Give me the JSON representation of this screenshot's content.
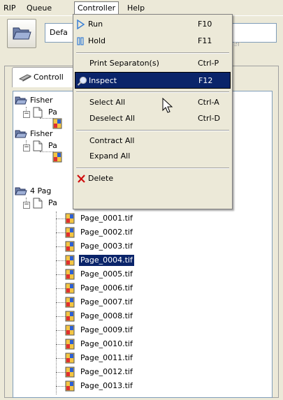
{
  "menubar": {
    "items": [
      {
        "label": "RIP"
      },
      {
        "label": "Queue"
      },
      {
        "label": "Controller"
      },
      {
        "label": "Help"
      }
    ]
  },
  "toolbar": {
    "combo_value": "Defa",
    "combo_ghost_text": "er"
  },
  "tab": {
    "label": "Controll"
  },
  "tree": {
    "groups": [
      {
        "label": "Fisher",
        "child": "Pa"
      },
      {
        "label": "Fisher",
        "child": "Pa"
      },
      {
        "label": "4 Pag",
        "child": "Pa"
      }
    ],
    "pages": [
      "Page_0001.tif",
      "Page_0002.tif",
      "Page_0003.tif",
      "Page_0004.tif",
      "Page_0005.tif",
      "Page_0006.tif",
      "Page_0007.tif",
      "Page_0008.tif",
      "Page_0009.tif",
      "Page_0010.tif",
      "Page_0011.tif",
      "Page_0012.tif",
      "Page_0013.tif"
    ],
    "selected_page": "Page_0004.tif"
  },
  "controller_menu": {
    "run": {
      "label": "Run",
      "shortcut": "F10"
    },
    "hold": {
      "label": "Hold",
      "shortcut": "F11"
    },
    "print_separations": {
      "label": "Print Separaton(s)",
      "shortcut": "Ctrl-P"
    },
    "inspect": {
      "label": "Inspect",
      "shortcut": "F12"
    },
    "select_all": {
      "label": "Select All",
      "shortcut": "Ctrl-A"
    },
    "deselect_all": {
      "label": "Deselect All",
      "shortcut": "Ctrl-D"
    },
    "contract_all": {
      "label": "Contract All"
    },
    "expand_all": {
      "label": "Expand All"
    },
    "delete": {
      "label": "Delete"
    },
    "highlighted": "Inspect"
  },
  "colors": {
    "selection": "#0a246a",
    "window_bg": "#ece9d8",
    "run_icon": "#3a7fd5",
    "delete_icon": "#d01010"
  }
}
